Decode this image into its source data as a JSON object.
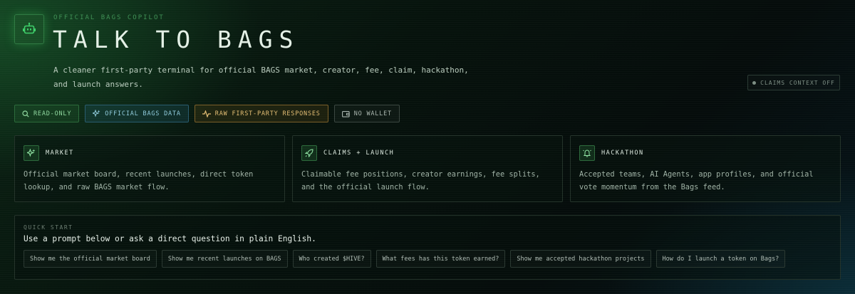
{
  "header": {
    "eyebrow": "OFFICIAL BAGS COPILOT",
    "title": "TALK TO BAGS",
    "subtitle_line1": "A cleaner first-party terminal for official BAGS market, creator, fee, claim, hackathon,",
    "subtitle_line2": "and launch answers.",
    "logo_icon": "robot-icon"
  },
  "claims_context": {
    "label": "CLAIMS CONTEXT OFF",
    "status_color": "#7d8e84"
  },
  "pills": [
    {
      "label": "READ-ONLY",
      "icon": "search-icon",
      "color": "#8fd79e"
    },
    {
      "label": "OFFICIAL BAGS DATA",
      "icon": "sparkle-icon",
      "color": "#8fcadb"
    },
    {
      "label": "RAW FIRST-PARTY RESPONSES",
      "icon": "activity-icon",
      "color": "#e3bd73"
    },
    {
      "label": "NO WALLET",
      "icon": "wallet-icon",
      "color": "#a9b5ae"
    }
  ],
  "cards": [
    {
      "title": "MARKET",
      "icon": "sparkle-icon",
      "body": "Official market board, recent launches, direct token lookup, and raw BAGS market flow."
    },
    {
      "title": "CLAIMS + LAUNCH",
      "icon": "rocket-icon",
      "body": "Claimable fee positions, creator earnings, fee splits, and the official launch flow."
    },
    {
      "title": "HACKATHON",
      "icon": "bell-icon",
      "body": "Accepted teams, AI Agents, app profiles, and official vote momentum from the Bags feed."
    }
  ],
  "quick_start": {
    "label": "QUICK START",
    "text": "Use a prompt below or ask a direct question in plain English.",
    "prompts": [
      "Show me the official market board",
      "Show me recent launches on BAGS",
      "Who created $HIVE?",
      "What fees has this token earned?",
      "Show me accepted hackathon projects",
      "How do I launch a token on Bags?"
    ]
  },
  "colors": {
    "accent_green": "#3ecf6a",
    "blue": "#8fcadb",
    "amber": "#e3bd73"
  }
}
